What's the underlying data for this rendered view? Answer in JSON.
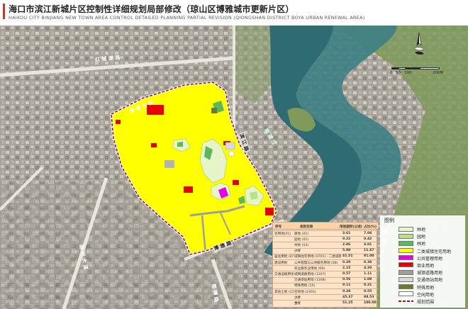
{
  "title": {
    "main": "海口市滨江新城片区控制性详细规划局部修改（琼山区博雅城市更新片区）",
    "sub": "HAIKOU CITY BINJIANG NEW TOWN AREA CONTROL DETAILED PLANNING PARTIAL REVISION (QIONGSHAN DISTRICT BOYA URBAN RENEWAL AREA)"
  },
  "colors": {
    "title_accent": "#c0392b",
    "residential": "#ffff00",
    "green_space": "#e8f5c8",
    "park": "#b5e38a",
    "forest": "#5cb85c",
    "public_service": "#e600e6",
    "commercial": "#e60000",
    "road": "#9e9e9e",
    "transport": "#d9d9d9",
    "special": "#6b7c2a",
    "boundary": "#8b1a1a",
    "river": "#2e6b73",
    "table_bg": "#fde3c8"
  },
  "map": {
    "road_labels": [
      "红 城 湖 路",
      "高 登 东 街",
      "滨 江 路",
      "博 雅 路",
      "琼 州 大 道",
      "椰 博 路",
      "南 渡 江"
    ],
    "scale": [
      "0",
      "50",
      "100",
      "200M"
    ]
  },
  "legend": {
    "title": "图例",
    "items": [
      {
        "label": "林地",
        "color": "#e8f5c8",
        "icon": "swatch"
      },
      {
        "label": "园地",
        "color": "#b5e38a",
        "icon": "swatch"
      },
      {
        "label": "林地",
        "color": "#5cb85c",
        "icon": "swatch"
      },
      {
        "label": "二类城镇住宅用地",
        "color": "#ffff00",
        "icon": "swatch"
      },
      {
        "label": "公共管理用地",
        "color": "#e600e6",
        "icon": "swatch"
      },
      {
        "label": "商业用地",
        "color": "#e60000",
        "icon": "swatch"
      },
      {
        "label": "城镇道路用地",
        "color": "#9e9e9e",
        "icon": "swatch"
      },
      {
        "label": "交通场站用地",
        "color": "#d9d9d9",
        "icon": "swatch"
      },
      {
        "label": "特殊用地",
        "color": "#6b7c2a",
        "icon": "swatch"
      },
      {
        "label": "空闲用地",
        "color": "#ffffff",
        "icon": "swatch"
      },
      {
        "label": "规划范围",
        "color": "#8b1a1a",
        "icon": "boundary-line"
      }
    ]
  },
  "stats_table": {
    "headers": [
      "序号",
      "类别名称",
      "用地面积(公顷)",
      "占比(%)"
    ],
    "rows": [
      {
        "group": "农用地(01)",
        "name": "耕地 (01)",
        "area": "3.61",
        "pct": "7.04"
      },
      {
        "group": "",
        "name": "园地 (02)",
        "area": "0.22",
        "pct": "0.42"
      },
      {
        "group": "",
        "name": "林地 (03)",
        "area": "2.06",
        "pct": "4.01"
      },
      {
        "group": "",
        "name": "小计",
        "area": "5.88",
        "pct": "11.47"
      },
      {
        "group": "居住用地 (07)",
        "name": "城镇住宅用地 (0701) · 二类城镇住宅用地 (070102)",
        "area": "41.51",
        "pct": "81.00"
      },
      {
        "group": "建设用地",
        "name": "公共管理与公共服务用地 (08)",
        "area": "0.20",
        "pct": "0.38"
      },
      {
        "group": "",
        "name": "商业服务业用地 (09)",
        "area": "2.15",
        "pct": "4.20"
      },
      {
        "group": "交通运输用地 (12)",
        "name": "城镇道路用地 (1207)",
        "area": "0.57",
        "pct": "1.11"
      },
      {
        "group": "",
        "name": "交通场站用地 (1208)",
        "area": "0.56",
        "pct": "1.08"
      },
      {
        "group": "",
        "name": "特殊用地 (15)",
        "area": "0.11",
        "pct": "0.21"
      },
      {
        "group": "其他土地 (23)",
        "name": "空闲地 (2301)",
        "area": "0.28",
        "pct": "0.55"
      },
      {
        "group": "",
        "name": "小计",
        "area": "45.37",
        "pct": "88.53"
      },
      {
        "group": "",
        "name": "合计",
        "area": "51.25",
        "pct": "100.00"
      }
    ]
  }
}
